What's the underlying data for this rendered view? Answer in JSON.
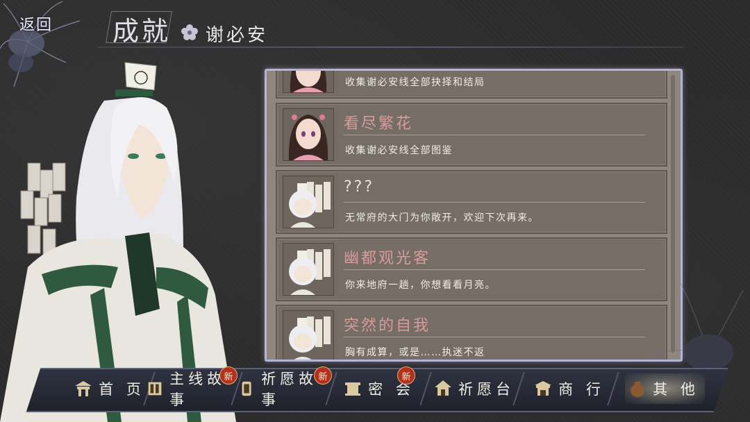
{
  "header": {
    "back_label": "返回",
    "title": "成就",
    "character_name": "谢必安"
  },
  "achievements": [
    {
      "title": "",
      "desc": "收集谢必安线全部抉择和结局",
      "portrait": "girl-portrait"
    },
    {
      "title": "看尽繁花",
      "desc": "收集谢必安线全部图鉴",
      "portrait": "girl-portrait"
    },
    {
      "title": "???",
      "desc": "无常府的大门为你敞开，欢迎下次再来。",
      "portrait": "chibi-portrait"
    },
    {
      "title": "幽都观光客",
      "desc": "你来地府一趟，你想看看月亮。",
      "portrait": "chibi-portrait"
    },
    {
      "title": "突然的自我",
      "desc": "胸有成算，或是……执迷不返",
      "portrait": "chibi-portrait"
    }
  ],
  "nav": {
    "items": [
      {
        "label": "首 页",
        "icon": "home-gate-icon",
        "new": false
      },
      {
        "label": "主线故事",
        "icon": "book-icon",
        "new": true
      },
      {
        "label": "祈愿故事",
        "icon": "scroll-icon",
        "new": true
      },
      {
        "label": "密 会",
        "icon": "meeting-icon",
        "new": true
      },
      {
        "label": "祈愿台",
        "icon": "altar-icon",
        "new": false
      },
      {
        "label": "商 行",
        "icon": "shop-icon",
        "new": false
      },
      {
        "label": "其 他",
        "icon": "bag-icon",
        "new": false
      }
    ],
    "new_badge": "新"
  }
}
